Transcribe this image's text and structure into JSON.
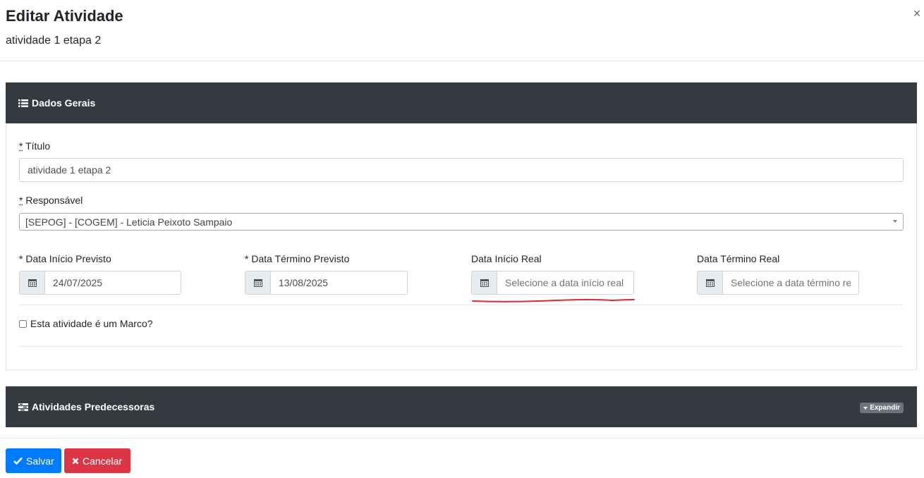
{
  "modal": {
    "title": "Editar Atividade",
    "subtitle": "atividade 1 etapa 2",
    "close_label": "×"
  },
  "general_panel": {
    "title": "Dados Gerais",
    "icon": "list-icon"
  },
  "form": {
    "titulo": {
      "required_mark": "*",
      "label": " Título",
      "value": "atividade 1 etapa 2"
    },
    "responsavel": {
      "required_mark": "*",
      "label": " Responsável",
      "value": "[SEPOG] - [COGEM] - Leticia Peixoto Sampaio"
    },
    "data_inicio_previsto": {
      "label": "* Data Início Previsto",
      "value": "24/07/2025"
    },
    "data_termino_previsto": {
      "label": "* Data Término Previsto",
      "value": "13/08/2025"
    },
    "data_inicio_real": {
      "label": "Data Início Real",
      "placeholder": "Selecione a data início real"
    },
    "data_termino_real": {
      "label": "Data Término Real",
      "placeholder": "Selecione a data término real"
    },
    "marco": {
      "label": "Esta atividade é um Marco?",
      "checked": false
    }
  },
  "predecessors_panel": {
    "title": "Atividades Predecessoras",
    "icon": "tasks-icon",
    "expand_label": "Expandir"
  },
  "footer": {
    "save_label": "Salvar",
    "cancel_label": "Cancelar"
  },
  "colors": {
    "panel_header": "#343a40",
    "primary": "#007bff",
    "danger": "#dc3545",
    "annotation": "#e0252b"
  }
}
